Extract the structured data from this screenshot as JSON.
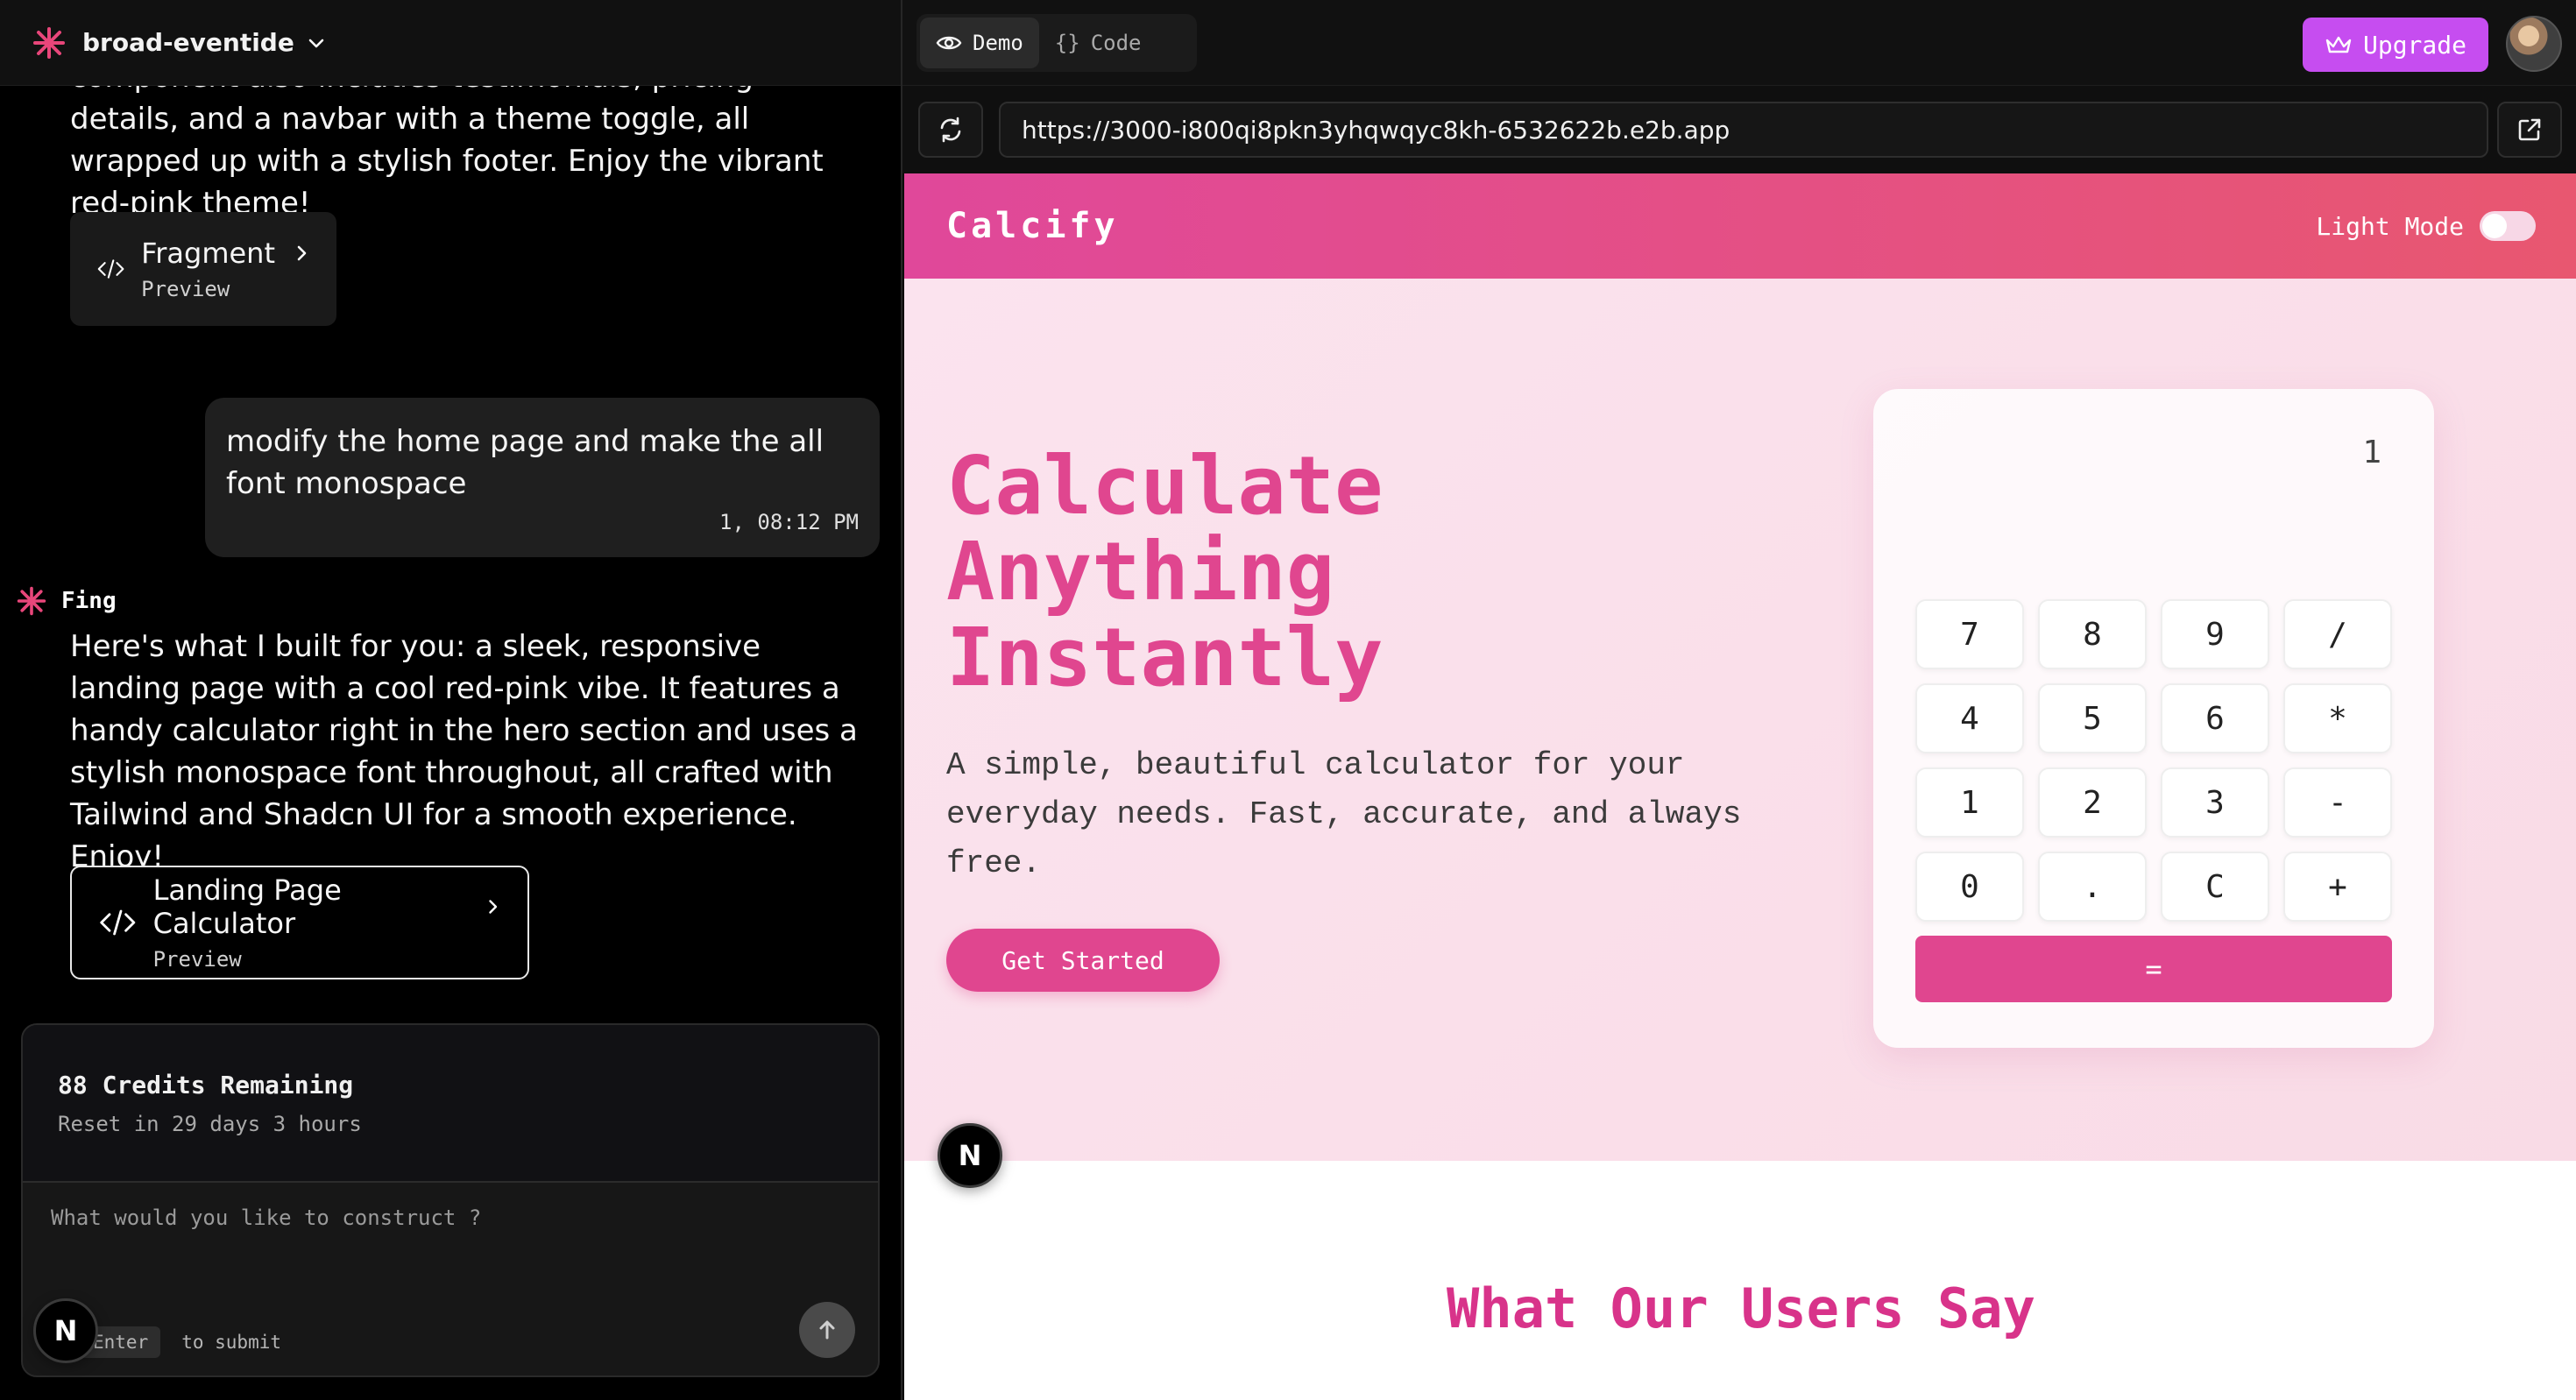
{
  "project": {
    "name": "broad-eventide"
  },
  "chat": {
    "previous_message_tail": "component also includes testimonials, pricing details, and a navbar with a theme toggle, all wrapped up with a stylish footer. Enjoy the vibrant red-pink theme!",
    "fragment_1": {
      "title": "Fragment",
      "subtitle": "Preview"
    },
    "user_message": {
      "text": "modify the home page and make the all font monospace",
      "time": "1, 08:12 PM"
    },
    "assistant": {
      "name": "Fing",
      "text": "Here's what I built for you: a sleek, responsive landing page with a cool red-pink vibe. It features a handy calculator right in the hero section and uses a stylish monospace font throughout, all crafted with Tailwind and Shadcn UI for a smooth experience. Enjoy!"
    },
    "fragment_2": {
      "title": "Landing Page Calculator",
      "subtitle": "Preview"
    }
  },
  "composer": {
    "credits_title": "88 Credits Remaining",
    "credits_reset": "Reset in 29 days 3 hours",
    "placeholder": "What would you like to construct ?",
    "enter_key": "Enter",
    "enter_hint": "to submit",
    "badge_letter": "N"
  },
  "toolbar": {
    "tabs": [
      {
        "label": "Demo",
        "icon": "eye-icon",
        "active": true
      },
      {
        "label": "Code",
        "icon": "braces-icon",
        "active": false
      }
    ],
    "upgrade_label": "Upgrade",
    "url": "https://3000-i800qi8pkn3yhqwqyc8kh-6532622b.e2b.app"
  },
  "site": {
    "brand": "Calcify",
    "theme_label": "Light Mode",
    "hero": {
      "title_lines": [
        "Calculate",
        "Anything",
        "Instantly"
      ],
      "subtitle": "A simple, beautiful calculator for your everyday needs. Fast, accurate, and always free.",
      "cta": "Get Started"
    },
    "calculator": {
      "display": "1",
      "keys": [
        "7",
        "8",
        "9",
        "/",
        "4",
        "5",
        "6",
        "*",
        "1",
        "2",
        "3",
        "-",
        "0",
        ".",
        "C",
        "+"
      ],
      "equals": "="
    },
    "testimonials_title": "What Our Users Say"
  },
  "colors": {
    "accent_pink": "#e0468f",
    "upgrade_purple": "#c64df0",
    "hero_bg": "#fbe3ee"
  }
}
